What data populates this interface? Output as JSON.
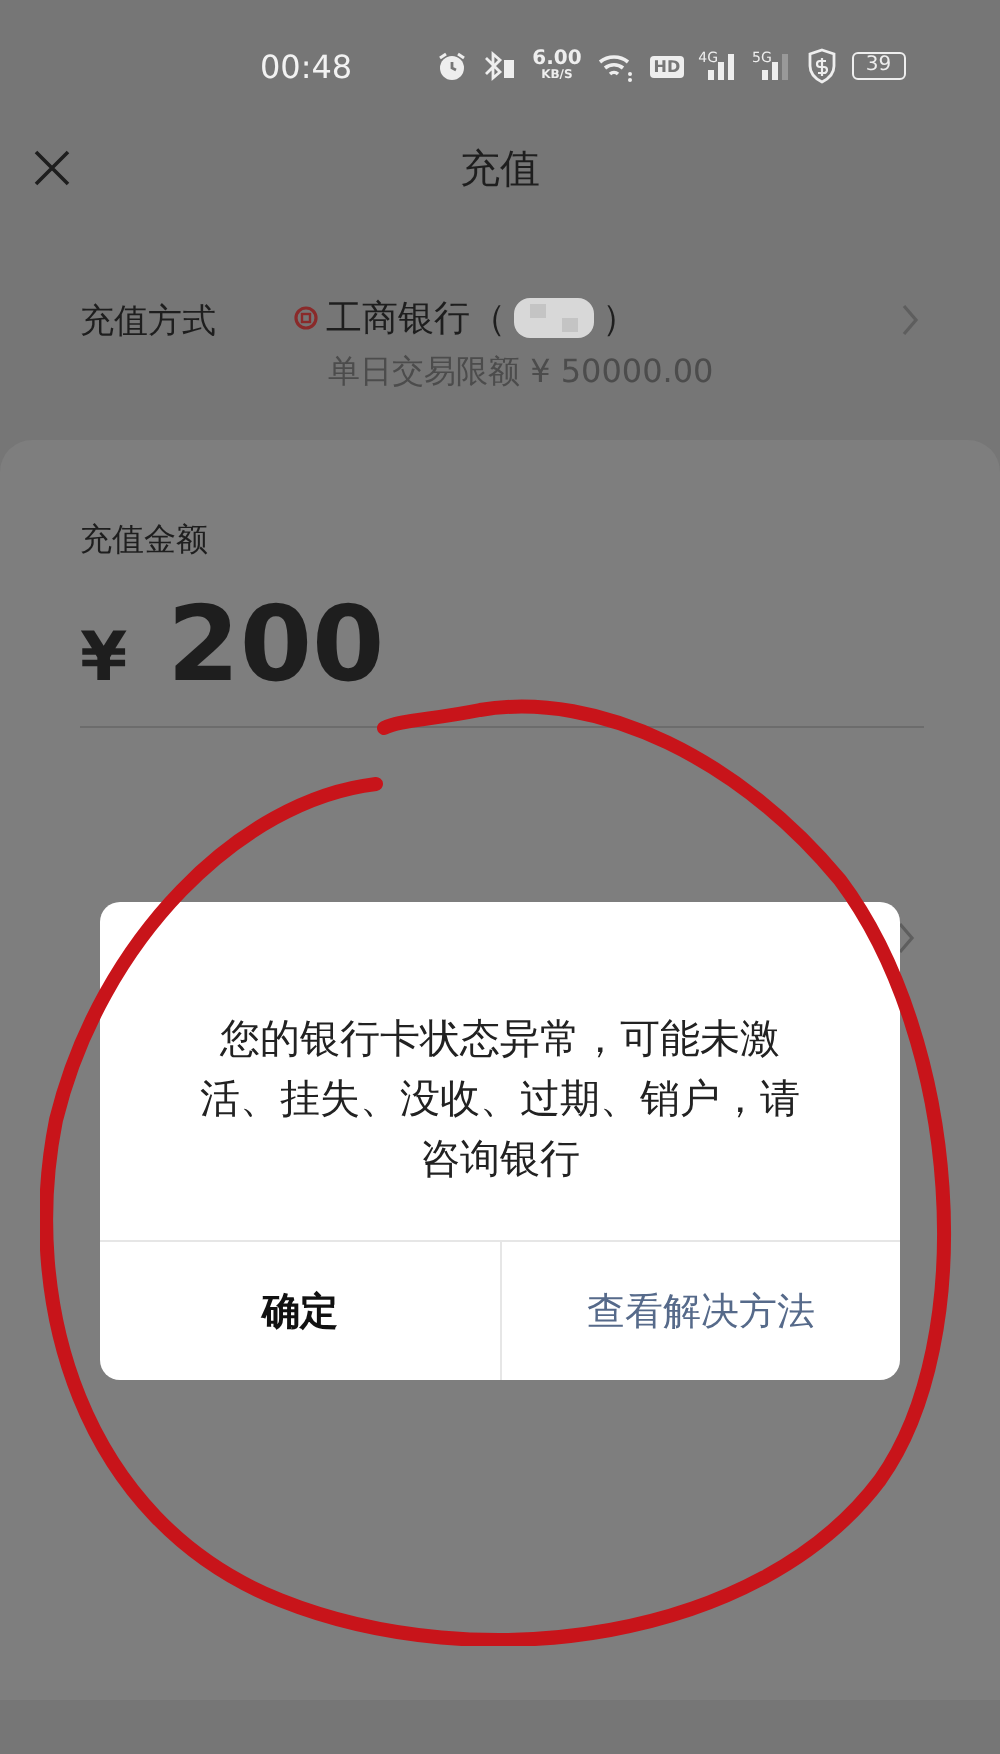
{
  "status_bar": {
    "time": "00:48",
    "net_speed_value": "6.00",
    "net_speed_unit": "KB/S",
    "hd_label": "HD",
    "signal_1_label": "4G",
    "signal_2_label": "5G",
    "battery": "39"
  },
  "header": {
    "title": "充值"
  },
  "payment_method": {
    "label": "充值方式",
    "bank_name": "工商银行（",
    "bank_name_end": "）",
    "limit": "单日交易限额 ¥ 50000.00"
  },
  "amount": {
    "label": "充值金额",
    "currency": "¥",
    "value": "200"
  },
  "dialog": {
    "message": "您的银行卡状态异常，可能未激活、挂失、没收、过期、销户，请咨询银行",
    "buttons": [
      {
        "label": "确定",
        "kind": "primary"
      },
      {
        "label": "查看解决方法",
        "kind": "link"
      }
    ]
  }
}
